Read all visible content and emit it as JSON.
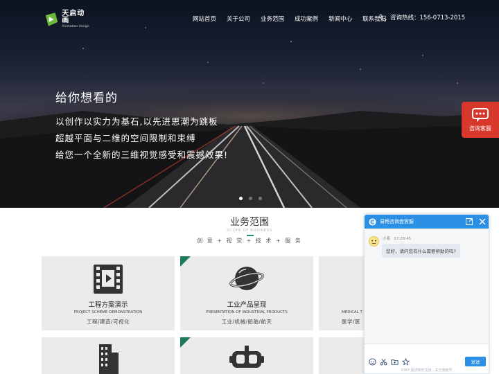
{
  "header": {
    "logo": {
      "name": "天启动画",
      "tagline": "Animation design"
    },
    "nav": [
      "网站首页",
      "关于公司",
      "业务范围",
      "成功案例",
      "新闻中心",
      "联系我们"
    ],
    "hotline": "咨询热线：156-0713-2015"
  },
  "hero": {
    "title": "给你想看的",
    "lines": [
      "以创作以实力为基石,以先进思潮为跳板",
      "超越平面与二维的空间限制和束缚",
      "给您一个全新的三维视觉感受和震撼效果!"
    ],
    "slide_count": 3,
    "active_slide": 1
  },
  "side_consult": {
    "label": "咨询客服"
  },
  "services": {
    "title": "业务范围",
    "subtitle": "SCOPE OF BUSINESS",
    "tags": "创 意 + 视 觉 + 技 术 + 服 务",
    "cards": [
      {
        "icon": "film-icon",
        "title": "工程方案演示",
        "en": "PROJECT SCHEME DEMONSTRATION",
        "tags": "工程/建造/可视化",
        "highlighted": false
      },
      {
        "icon": "planet-icon",
        "title": "工业产品呈现",
        "en": "PRESENTATION OF INDUSTRIAL PRODUCTS",
        "tags": "工业/机械/船舶/航天",
        "highlighted": true
      },
      {
        "icon": "medical-icon",
        "title": "",
        "en": "MEDICAL T",
        "tags": "医学/医",
        "highlighted": false
      },
      {
        "icon": "building-icon",
        "title": "",
        "en": "",
        "tags": "",
        "highlighted": false
      },
      {
        "icon": "vr-headset-icon",
        "title": "",
        "en": "",
        "tags": "",
        "highlighted": true
      },
      {
        "icon": "",
        "title": "",
        "en": "",
        "tags": "",
        "highlighted": false
      }
    ]
  },
  "chat": {
    "header_title": "易畅咨询盘客服",
    "agent_name": "小易",
    "time": "17:28:45",
    "message": "您好，请问您有什么需要帮助的吗?",
    "send_label": "发送",
    "footer": "53KF 提供软件支持 · 关于我帐号"
  },
  "colors": {
    "accent_green": "#1d7a5a",
    "chat_blue": "#2b8fe3",
    "consult_red": "#d8372b"
  }
}
